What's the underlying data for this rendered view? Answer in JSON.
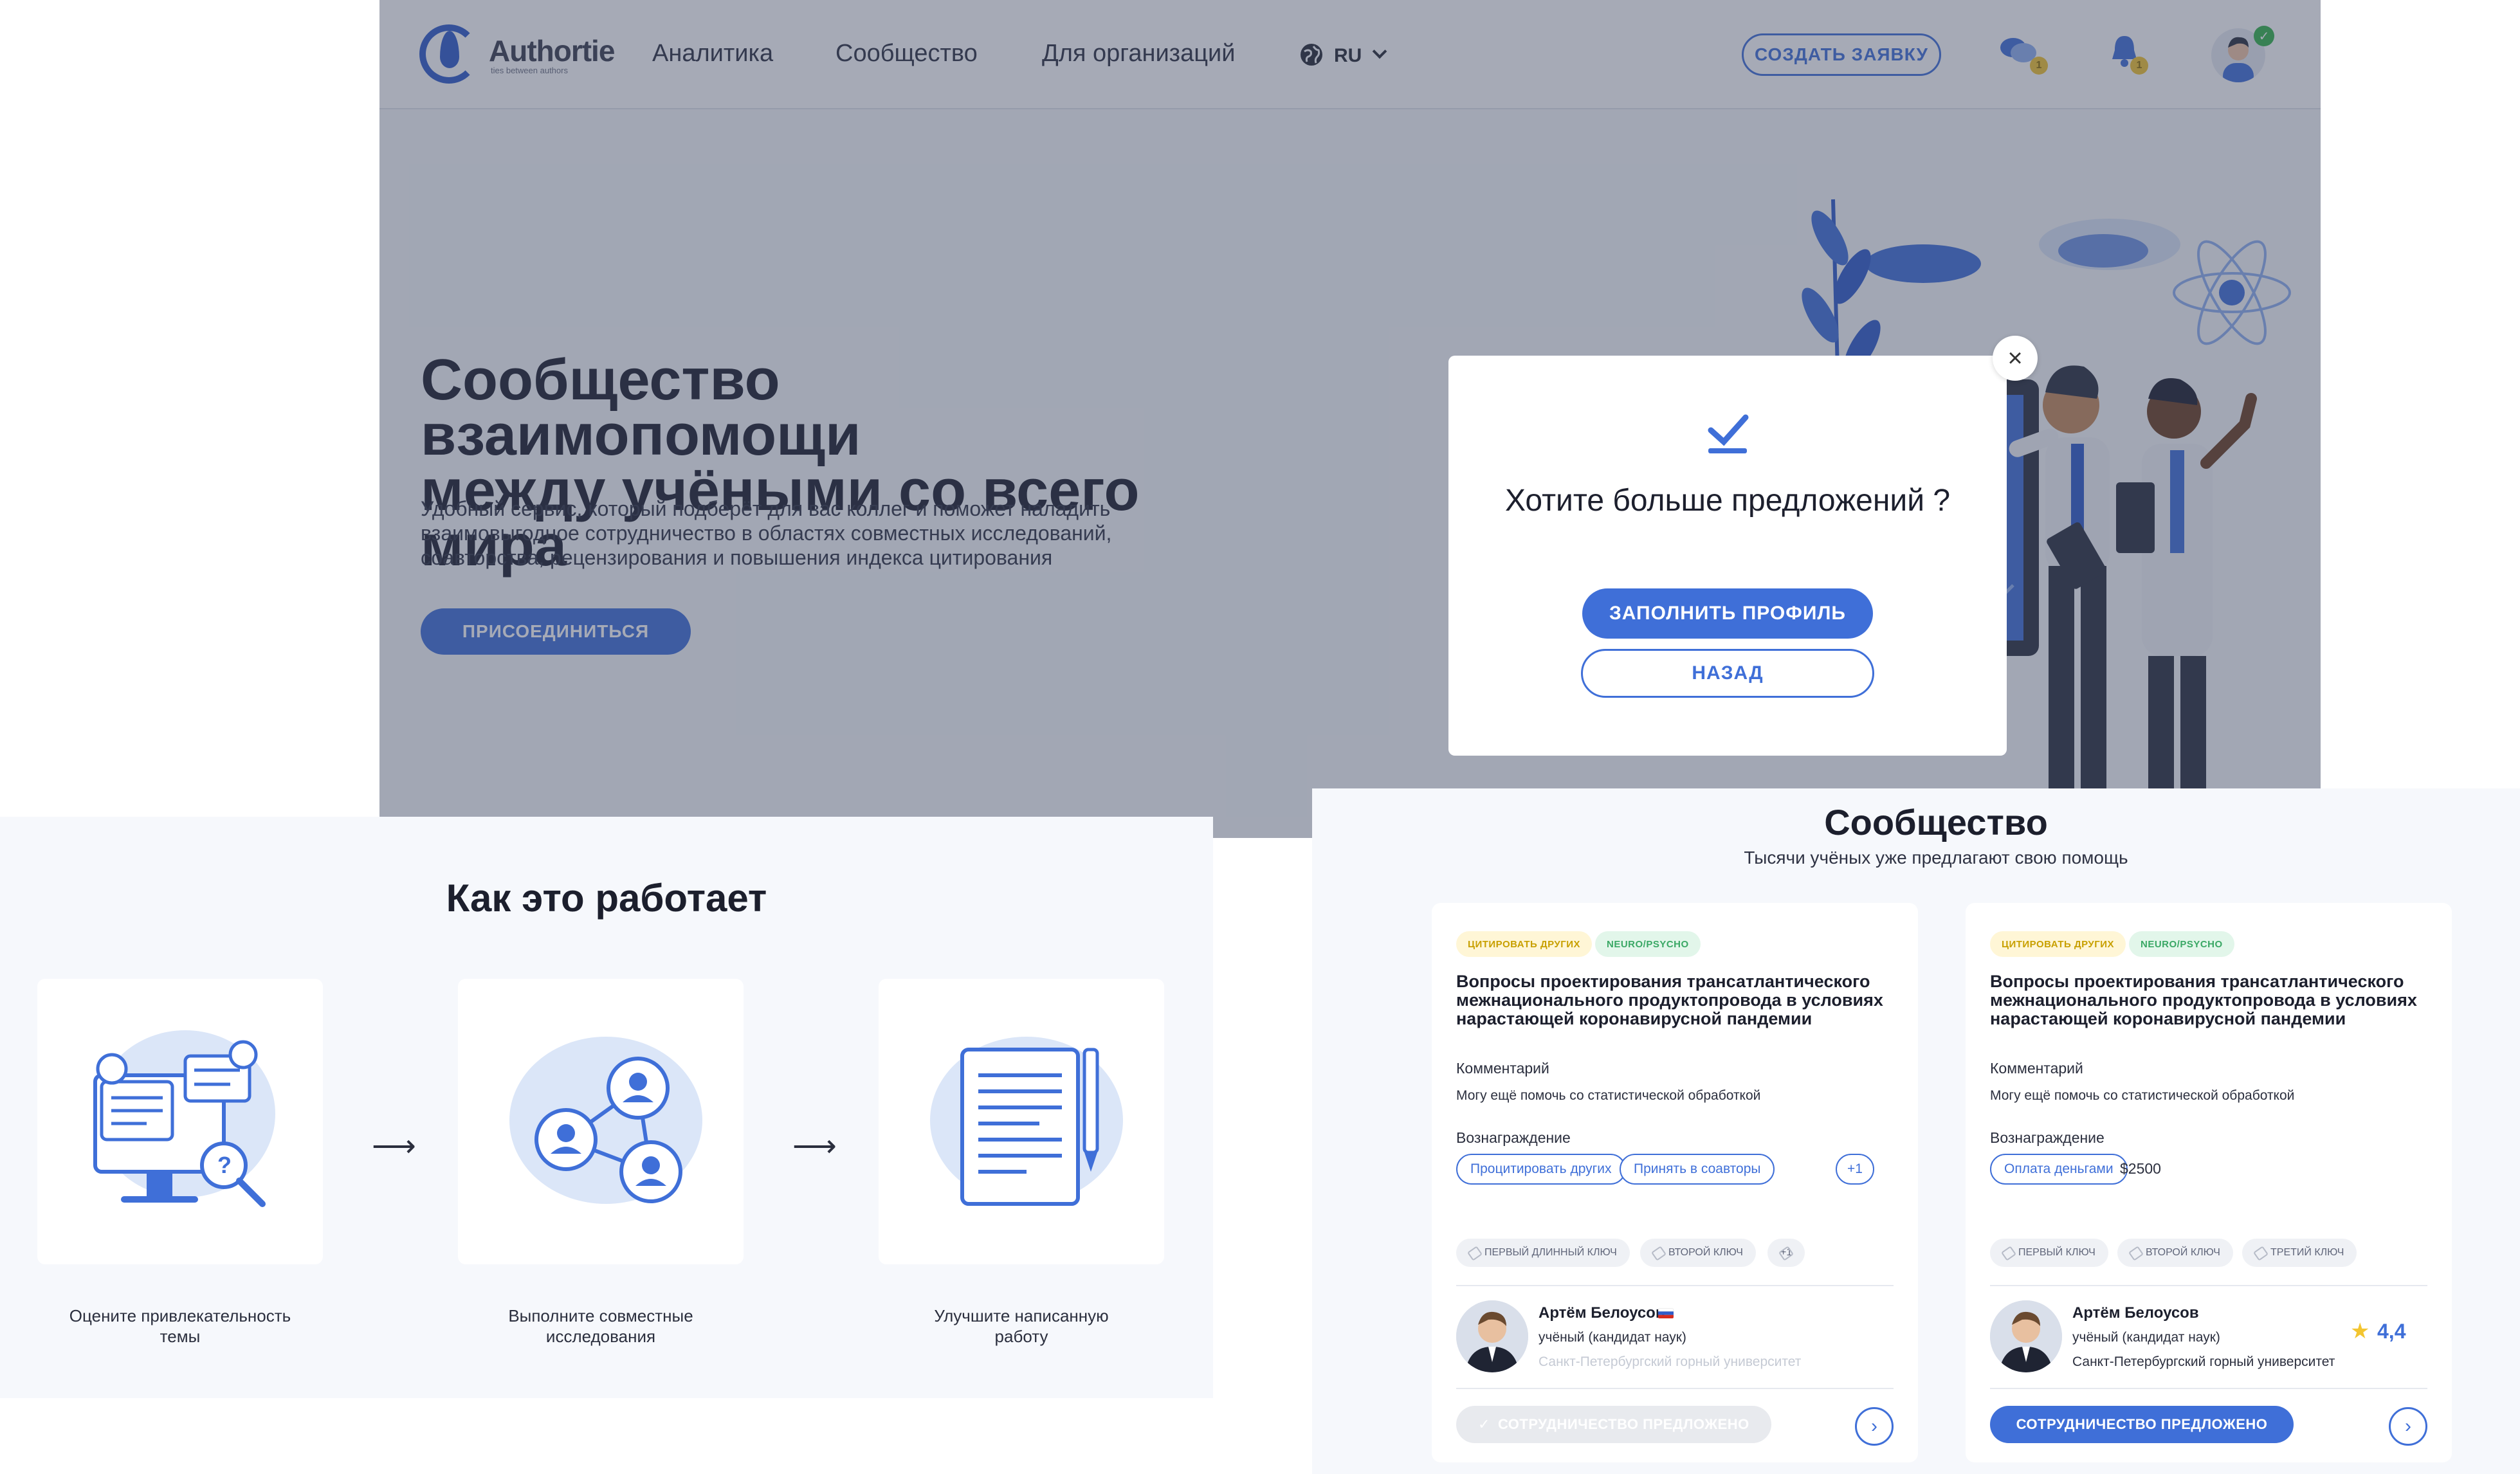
{
  "header": {
    "logo_text": "Authortie",
    "logo_sub": "ties between authors",
    "nav": [
      "Аналитика",
      "Сообщество",
      "Для организаций"
    ],
    "lang": "RU",
    "create_button": "СОЗДАТЬ ЗАЯВКУ",
    "chat_badge": "1",
    "bell_badge": "1"
  },
  "hero": {
    "title_line1": "Сообщество взаимопомощи",
    "title_line2": "между учёными со всего мира",
    "desc_line1": "Удобный сервис, который подберёт для вас коллег и поможет наладить",
    "desc_line2": "взаимовыгодное сотрудничество в областях совместных исследований,",
    "desc_line3": "соавторства, рецензирования и повышения индекса цитирования",
    "join_button": "ПРИСОЕДИНИТЬСЯ"
  },
  "modal": {
    "title": "Хотите больше предложений ?",
    "fill_button": "ЗАПОЛНИТЬ ПРОФИЛЬ",
    "back_button": "НАЗАД",
    "close": "×"
  },
  "how": {
    "title": "Как это работает",
    "steps": [
      {
        "l1": "Оцените привлекательность",
        "l2": "темы"
      },
      {
        "l1": "Выполните совместные",
        "l2": "исследования"
      },
      {
        "l1": "Улучшите написанную",
        "l2": "работу"
      }
    ],
    "arrow": "⟶"
  },
  "community": {
    "title": "Сообщество",
    "subtitle": "Тысячи учёных уже предлагают свою помощь",
    "cards": [
      {
        "tag1": "ЦИТИРОВАТЬ ДРУГИХ",
        "tag2": "NEURO/PSYCHO",
        "title": "Вопросы проектирования трансатлантического межнационального продуктопровода в условиях нарастающей коронавирусной пандемии",
        "comment_h": "Комментарий",
        "comment": "Могу ещё помочь со статистической обработкой",
        "reward_h": "Вознаграждение",
        "chips": [
          "Процитировать других",
          "Принять в соавторы",
          "+1"
        ],
        "keys": [
          "ПЕРВЫЙ ДЛИННЫЙ КЛЮЧ",
          "ВТОРОЙ КЛЮЧ",
          "+1"
        ],
        "name": "Артём Белоусов",
        "role": "учёный (кандидат наук)",
        "uni": "Санкт-Петербургский горный университет",
        "coop": "СОТРУДНИЧЕСТВО ПРЕДЛОЖЕНО"
      },
      {
        "tag1": "ЦИТИРОВАТЬ ДРУГИХ",
        "tag2": "NEURO/PSYCHO",
        "title": "Вопросы проектирования трансатлантического межнационального продуктопровода в условиях нарастающей коронавирусной пандемии",
        "comment_h": "Комментарий",
        "comment": "Могу ещё помочь со статистической обработкой",
        "reward_h": "Вознаграждение",
        "chips": [
          "Оплата деньгами"
        ],
        "price": "$2500",
        "keys": [
          "ПЕРВЫЙ КЛЮЧ",
          "ВТОРОЙ КЛЮЧ",
          "ТРЕТИЙ КЛЮЧ"
        ],
        "name": "Артём Белоусов",
        "role": "учёный (кандидат наук)",
        "uni": "Санкт-Петербургский горный университет",
        "rating": "4,4",
        "coop": "СОТРУДНИЧЕСТВО ПРЕДЛОЖЕНО"
      }
    ]
  },
  "colors": {
    "accent": "#3f6fd8",
    "text": "#1c1f2d",
    "overlay": "rgba(60,70,95,0.46)"
  }
}
